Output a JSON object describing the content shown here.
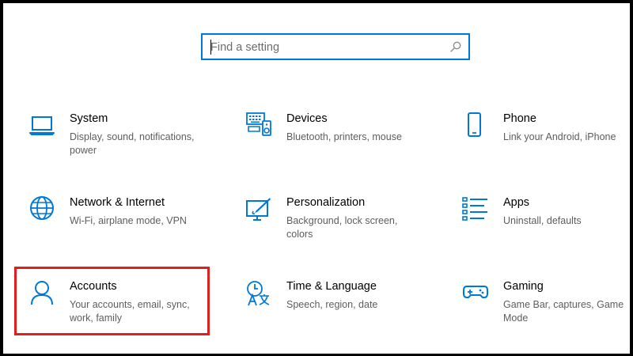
{
  "search": {
    "placeholder": "Find a setting",
    "value": ""
  },
  "accent_color": "#0078d7",
  "highlight_color": "#e0201e",
  "tiles": [
    {
      "title": "System",
      "description": "Display, sound, notifications, power",
      "icon": "laptop-icon"
    },
    {
      "title": "Devices",
      "description": "Bluetooth, printers, mouse",
      "icon": "devices-icon"
    },
    {
      "title": "Phone",
      "description": "Link your Android, iPhone",
      "icon": "phone-icon"
    },
    {
      "title": "Network & Internet",
      "description": "Wi-Fi, airplane mode, VPN",
      "icon": "globe-icon"
    },
    {
      "title": "Personalization",
      "description": "Background, lock screen, colors",
      "icon": "paint-icon"
    },
    {
      "title": "Apps",
      "description": "Uninstall, defaults",
      "icon": "apps-list-icon"
    },
    {
      "title": "Accounts",
      "description": "Your accounts, email, sync, work, family",
      "icon": "person-icon",
      "highlighted": true
    },
    {
      "title": "Time & Language",
      "description": "Speech, region, date",
      "icon": "time-language-icon"
    },
    {
      "title": "Gaming",
      "description": "Game Bar, captures, Game Mode",
      "icon": "gamepad-icon"
    }
  ]
}
